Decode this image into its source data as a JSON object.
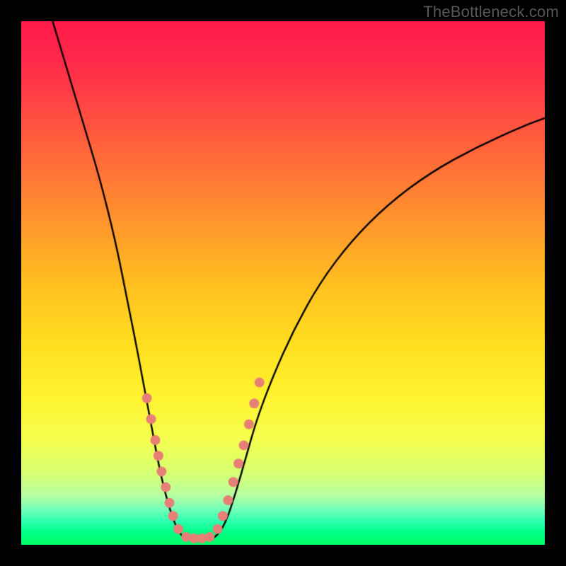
{
  "watermark": "TheBottleneck.com",
  "colors": {
    "frame": "#000000",
    "curve": "#000000",
    "marker_fill": "#e77f77",
    "marker_stroke": "#d86a62",
    "gradient_stops": [
      {
        "pos": 0.0,
        "color": "#ff1a4b"
      },
      {
        "pos": 0.08,
        "color": "#ff2a4a"
      },
      {
        "pos": 0.2,
        "color": "#ff5540"
      },
      {
        "pos": 0.35,
        "color": "#ff8a30"
      },
      {
        "pos": 0.5,
        "color": "#ffbf20"
      },
      {
        "pos": 0.62,
        "color": "#ffe020"
      },
      {
        "pos": 0.72,
        "color": "#fff430"
      },
      {
        "pos": 0.8,
        "color": "#f5ff50"
      },
      {
        "pos": 0.86,
        "color": "#d8ff70"
      },
      {
        "pos": 0.905,
        "color": "#b8ffa0"
      },
      {
        "pos": 0.93,
        "color": "#7affb8"
      },
      {
        "pos": 0.955,
        "color": "#30ffb0"
      },
      {
        "pos": 0.975,
        "color": "#00ff88"
      },
      {
        "pos": 1.0,
        "color": "#00ff66"
      }
    ]
  },
  "chart_data": {
    "type": "line",
    "title": "",
    "xlabel": "",
    "ylabel": "",
    "xlim": [
      0,
      100
    ],
    "ylim": [
      0,
      100
    ],
    "curve": {
      "left": [
        {
          "x": 6,
          "y": 100
        },
        {
          "x": 9,
          "y": 90
        },
        {
          "x": 12,
          "y": 80
        },
        {
          "x": 15,
          "y": 70
        },
        {
          "x": 18,
          "y": 58
        },
        {
          "x": 20,
          "y": 48
        },
        {
          "x": 22,
          "y": 38
        },
        {
          "x": 23.5,
          "y": 30
        },
        {
          "x": 25,
          "y": 22
        },
        {
          "x": 26.5,
          "y": 14
        },
        {
          "x": 28,
          "y": 8
        },
        {
          "x": 29.5,
          "y": 3.5
        },
        {
          "x": 31,
          "y": 1.2
        }
      ],
      "bottom": [
        {
          "x": 31,
          "y": 1.2
        },
        {
          "x": 33,
          "y": 0.9
        },
        {
          "x": 35,
          "y": 0.9
        },
        {
          "x": 37,
          "y": 1.2
        }
      ],
      "right": [
        {
          "x": 37,
          "y": 1.2
        },
        {
          "x": 39,
          "y": 4
        },
        {
          "x": 41,
          "y": 10
        },
        {
          "x": 43,
          "y": 17
        },
        {
          "x": 45,
          "y": 24
        },
        {
          "x": 48,
          "y": 32
        },
        {
          "x": 52,
          "y": 41
        },
        {
          "x": 57,
          "y": 50
        },
        {
          "x": 63,
          "y": 58
        },
        {
          "x": 70,
          "y": 65
        },
        {
          "x": 78,
          "y": 71
        },
        {
          "x": 87,
          "y": 76
        },
        {
          "x": 96,
          "y": 80
        },
        {
          "x": 100,
          "y": 81.5
        }
      ]
    },
    "markers": [
      {
        "x": 24.0,
        "y": 28
      },
      {
        "x": 24.8,
        "y": 24
      },
      {
        "x": 25.6,
        "y": 20
      },
      {
        "x": 26.2,
        "y": 17
      },
      {
        "x": 26.8,
        "y": 14
      },
      {
        "x": 27.6,
        "y": 11
      },
      {
        "x": 28.3,
        "y": 8
      },
      {
        "x": 29.0,
        "y": 5.5
      },
      {
        "x": 30.0,
        "y": 3.0
      },
      {
        "x": 31.5,
        "y": 1.5
      },
      {
        "x": 33.0,
        "y": 1.2
      },
      {
        "x": 34.5,
        "y": 1.2
      },
      {
        "x": 36.0,
        "y": 1.5
      },
      {
        "x": 37.5,
        "y": 3.0
      },
      {
        "x": 38.5,
        "y": 5.5
      },
      {
        "x": 39.5,
        "y": 8.5
      },
      {
        "x": 40.5,
        "y": 12
      },
      {
        "x": 41.5,
        "y": 15.5
      },
      {
        "x": 42.5,
        "y": 19
      },
      {
        "x": 43.5,
        "y": 23
      },
      {
        "x": 44.5,
        "y": 27
      },
      {
        "x": 45.5,
        "y": 31
      }
    ],
    "marker_radius": 7
  }
}
